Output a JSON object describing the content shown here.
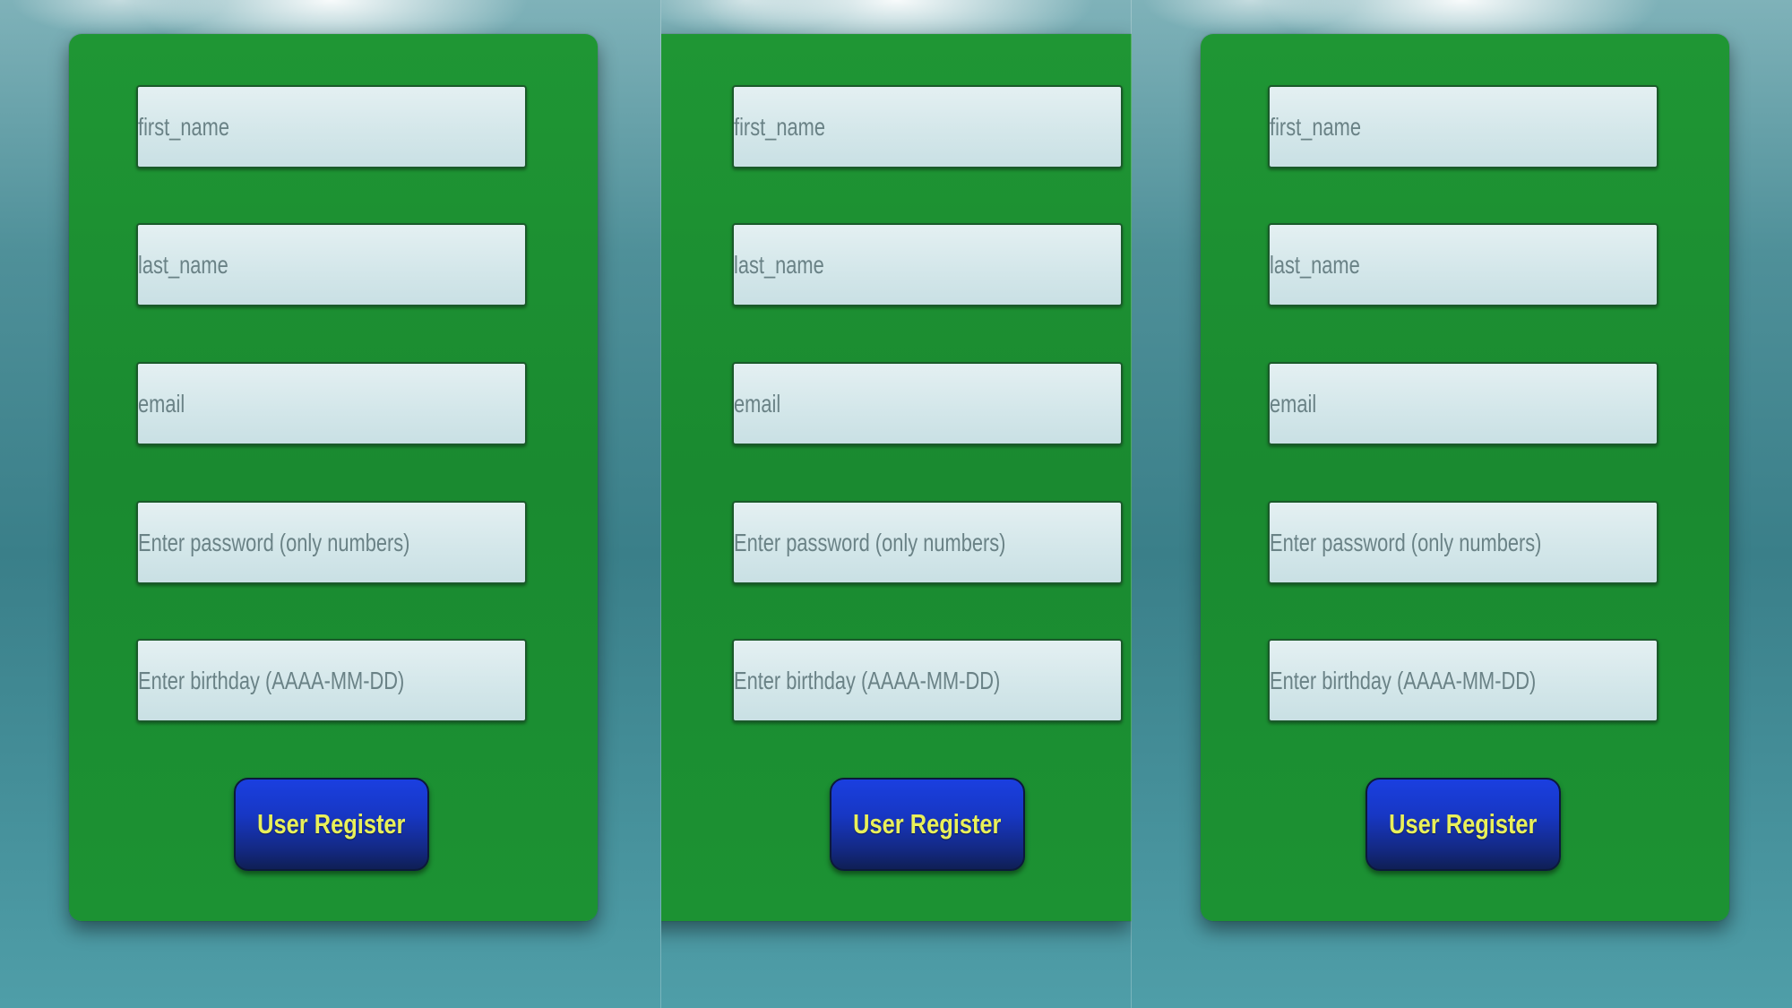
{
  "form": {
    "fields": [
      {
        "name": "first_name",
        "placeholder": "first_name"
      },
      {
        "name": "last_name",
        "placeholder": "last_name"
      },
      {
        "name": "email",
        "placeholder": "email"
      },
      {
        "name": "password",
        "placeholder": "Enter password (only numbers)"
      },
      {
        "name": "birthday",
        "placeholder": "Enter birthday (AAAA-MM-DD)"
      }
    ],
    "submit_label": "User Register"
  },
  "colors": {
    "card_green": "#1a8a30",
    "button_blue": "#1737c4",
    "button_text_yellow": "#e9f05a",
    "field_bg": "#d4e7ea",
    "background_teal": "#3f8791"
  }
}
